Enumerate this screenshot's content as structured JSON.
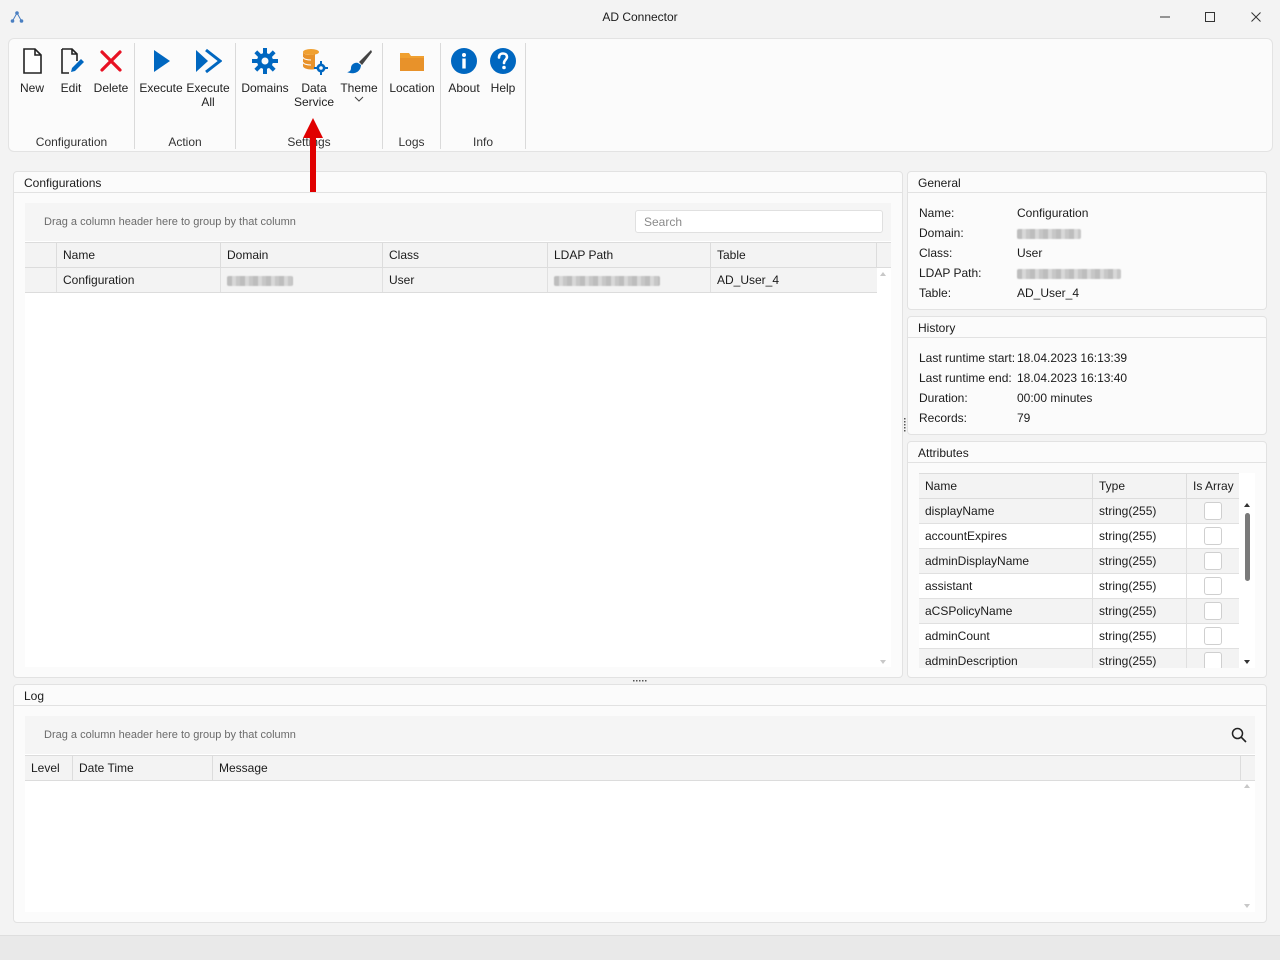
{
  "window": {
    "title": "AD Connector"
  },
  "ribbon": {
    "groups": {
      "configuration": {
        "label": "Configuration",
        "buttons": {
          "new": "New",
          "edit": "Edit",
          "delete": "Delete"
        }
      },
      "action": {
        "label": "Action",
        "buttons": {
          "execute": "Execute",
          "execute_all_1": "Execute",
          "execute_all_2": "All"
        }
      },
      "settings": {
        "label": "Settings",
        "buttons": {
          "domains": "Domains",
          "data_service_1": "Data",
          "data_service_2": "Service",
          "theme": "Theme"
        }
      },
      "logs": {
        "label": "Logs",
        "buttons": {
          "location": "Location"
        }
      },
      "info": {
        "label": "Info",
        "buttons": {
          "about": "About",
          "help": "Help"
        }
      }
    }
  },
  "configurations": {
    "title": "Configurations",
    "group_hint": "Drag a column header here to group by that column",
    "search_placeholder": "Search",
    "columns": [
      "Name",
      "Domain",
      "Class",
      "LDAP Path",
      "Table"
    ],
    "rows": [
      {
        "name": "Configuration",
        "class": "User",
        "table": "AD_User_4"
      }
    ]
  },
  "general": {
    "title": "General",
    "labels": {
      "name": "Name:",
      "domain": "Domain:",
      "class": "Class:",
      "ldap_path": "LDAP Path:",
      "table": "Table:"
    },
    "values": {
      "name": "Configuration",
      "class": "User",
      "table": "AD_User_4"
    }
  },
  "history": {
    "title": "History",
    "labels": {
      "start": "Last runtime start:",
      "end": "Last runtime end:",
      "duration": "Duration:",
      "records": "Records:"
    },
    "values": {
      "start": "18.04.2023 16:13:39",
      "end": "18.04.2023 16:13:40",
      "duration": "00:00 minutes",
      "records": "79"
    }
  },
  "attributes": {
    "title": "Attributes",
    "columns": [
      "Name",
      "Type",
      "Is Array"
    ],
    "rows": [
      {
        "name": "displayName",
        "type": "string(255)"
      },
      {
        "name": "accountExpires",
        "type": "string(255)"
      },
      {
        "name": "adminDisplayName",
        "type": "string(255)"
      },
      {
        "name": "assistant",
        "type": "string(255)"
      },
      {
        "name": "aCSPolicyName",
        "type": "string(255)"
      },
      {
        "name": "adminCount",
        "type": "string(255)"
      },
      {
        "name": "adminDescription",
        "type": "string(255)"
      }
    ]
  },
  "log": {
    "title": "Log",
    "group_hint": "Drag a column header here to group by that column",
    "columns": [
      "Level",
      "Date Time",
      "Message"
    ]
  },
  "colors": {
    "accent_blue": "#0067c0",
    "delete_red": "#e81123",
    "folder_orange": "#f0a030",
    "annotation_arrow": "#e00000"
  },
  "icons": {
    "new": "new-document-icon",
    "edit": "edit-document-icon",
    "delete": "delete-x-icon",
    "execute": "play-icon",
    "execute_all": "fast-forward-icon",
    "domains": "gear-icon",
    "data_service": "database-gear-icon",
    "theme": "paintbrush-icon",
    "location": "folder-icon",
    "about": "info-icon",
    "help": "help-icon"
  }
}
